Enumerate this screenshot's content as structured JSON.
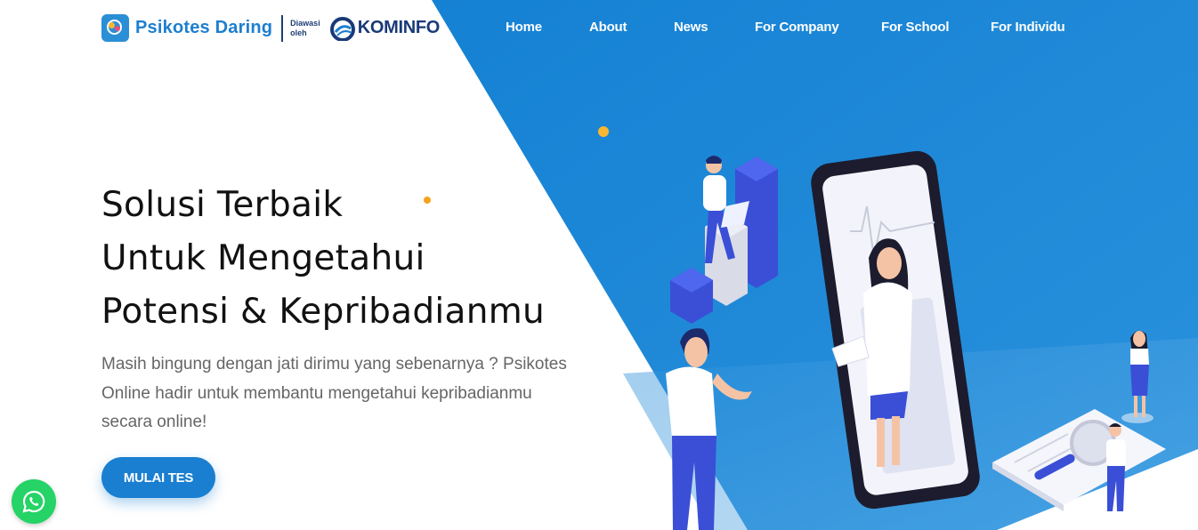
{
  "brand": {
    "name": "Psikotes Daring",
    "supervised_line1": "Diawasi",
    "supervised_line2": "oleh",
    "partner": "KOMINFO"
  },
  "nav": {
    "items": [
      {
        "label": "Home"
      },
      {
        "label": "About"
      },
      {
        "label": "News"
      },
      {
        "label": "For Company"
      },
      {
        "label": "For School"
      },
      {
        "label": "For Individu"
      }
    ]
  },
  "hero": {
    "title_lines": [
      "Solusi Terbaik",
      "Untuk Mengetahui",
      "Potensi & Kepribadianmu"
    ],
    "desc_lines": [
      "Masih bingung dengan jati dirimu yang sebenarnya ? Psikotes",
      "Online hadir untuk membantu mengetahui kepribadianmu",
      "secara online!"
    ],
    "cta_label": "MULAI TES"
  },
  "icons": {
    "brand_logo": "brain-logo-icon",
    "partner_logo": "kominfo-logo-icon",
    "chat": "whatsapp-icon"
  },
  "colors": {
    "primary": "#1a7fd0",
    "hero_bg_blue": "#1a80d3",
    "nav_text": "#ffffff",
    "accent_dot": "#f7b733",
    "whatsapp": "#25d366"
  }
}
